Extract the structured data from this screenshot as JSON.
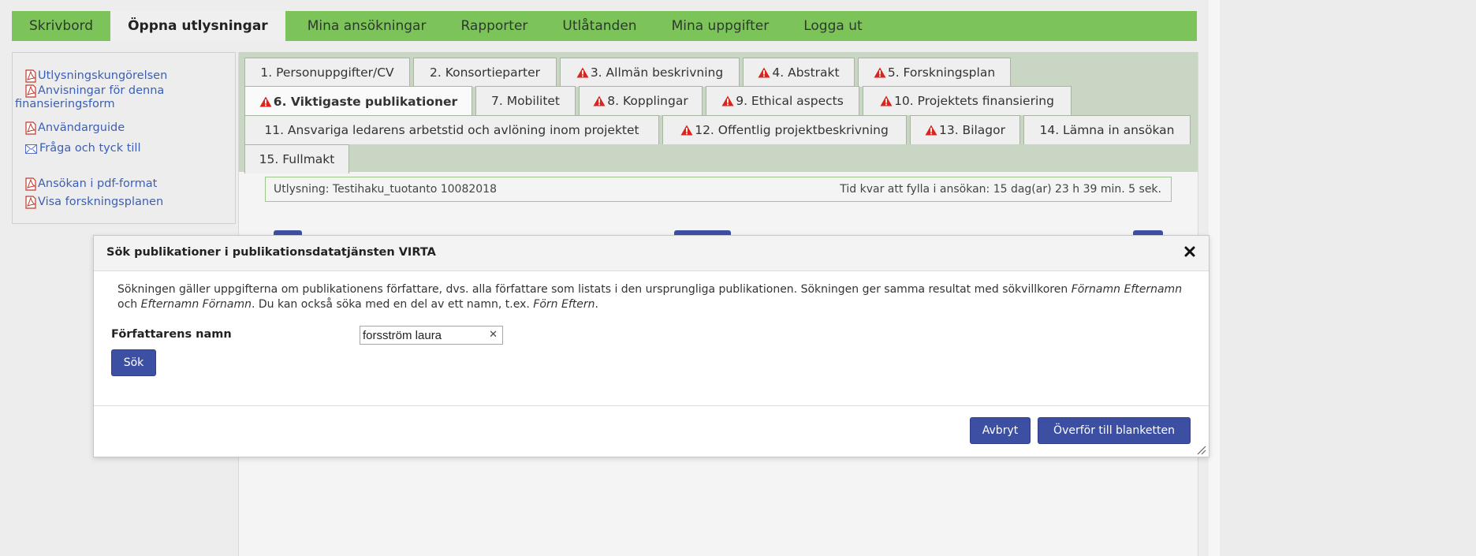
{
  "nav": {
    "items": [
      {
        "label": "Skrivbord"
      },
      {
        "label": "Öppna utlysningar"
      },
      {
        "label": "Mina ansökningar"
      },
      {
        "label": "Rapporter"
      },
      {
        "label": "Utlåtanden"
      },
      {
        "label": "Mina uppgifter"
      },
      {
        "label": "Logga ut"
      }
    ],
    "active_index": 1,
    "color": "#7cc45a"
  },
  "sidebar": {
    "links": [
      {
        "label": "Utlysningskungörelsen",
        "icon": "pdf-icon"
      },
      {
        "label": "Anvisningar för denna",
        "label2": "finansieringsform",
        "icon": "pdf-icon"
      },
      {
        "label": "Användarguide",
        "icon": "pdf-icon"
      },
      {
        "label": "Fråga och tyck till",
        "icon": "mail-icon"
      },
      {
        "label": "Ansökan i pdf-format",
        "icon": "pdf-icon"
      },
      {
        "label": "Visa forskningsplanen",
        "icon": "pdf-icon"
      }
    ]
  },
  "tabs": [
    {
      "label": "1. Personuppgifter/CV",
      "warning": false
    },
    {
      "label": "2. Konsortieparter",
      "warning": false
    },
    {
      "label": "3. Allmän beskrivning",
      "warning": true
    },
    {
      "label": "4. Abstrakt",
      "warning": true
    },
    {
      "label": "5. Forskningsplan",
      "warning": true
    },
    {
      "label": "6. Viktigaste publikationer",
      "warning": true,
      "active": true
    },
    {
      "label": "7. Mobilitet",
      "warning": false
    },
    {
      "label": "8. Kopplingar",
      "warning": true
    },
    {
      "label": "9. Ethical aspects",
      "warning": true
    },
    {
      "label": "10. Projektets finansiering",
      "warning": true
    },
    {
      "label": "11. Ansvariga ledarens arbetstid och avlöning inom projektet",
      "warning": false
    },
    {
      "label": "12. Offentlig projektbeskrivning",
      "warning": true
    },
    {
      "label": "13. Bilagor",
      "warning": true
    },
    {
      "label": "14. Lämna in ansökan",
      "warning": false
    },
    {
      "label": "15. Fullmakt",
      "warning": false
    }
  ],
  "info_bar": {
    "call": "Utlysning: Testihaku_tuotanto 10082018",
    "time_left": "Tid kvar att fylla i ansökan: 15 dag(ar) 23 h 39 min. 5 sek."
  },
  "modal": {
    "title": "Sök publikationer i publikationsdatatjänsten VIRTA",
    "desc_part1": "Sökningen gäller uppgifterna om publikationens författare, dvs. alla författare som listats i den ursprungliga publikationen. Sökningen ger samma resultat med sökvillkoren ",
    "desc_italic1": "Förnamn Efternamn",
    "desc_part2": " och ",
    "desc_italic2": "Efternamn Förnamn",
    "desc_part3": ". Du kan också söka med en del av ett namn, t.ex. ",
    "desc_italic3": "Förn Eftern",
    "desc_part4": ".",
    "field_label": "Författarens namn",
    "field_value": "forsström laura",
    "search_button": "Sök",
    "cancel_button": "Avbryt",
    "transfer_button": "Överför till blanketten"
  },
  "colors": {
    "accent": "#3c4fa3",
    "warning": "#d9251d",
    "link": "#3b5fb5",
    "tab_bar": "#c9d6c3"
  }
}
